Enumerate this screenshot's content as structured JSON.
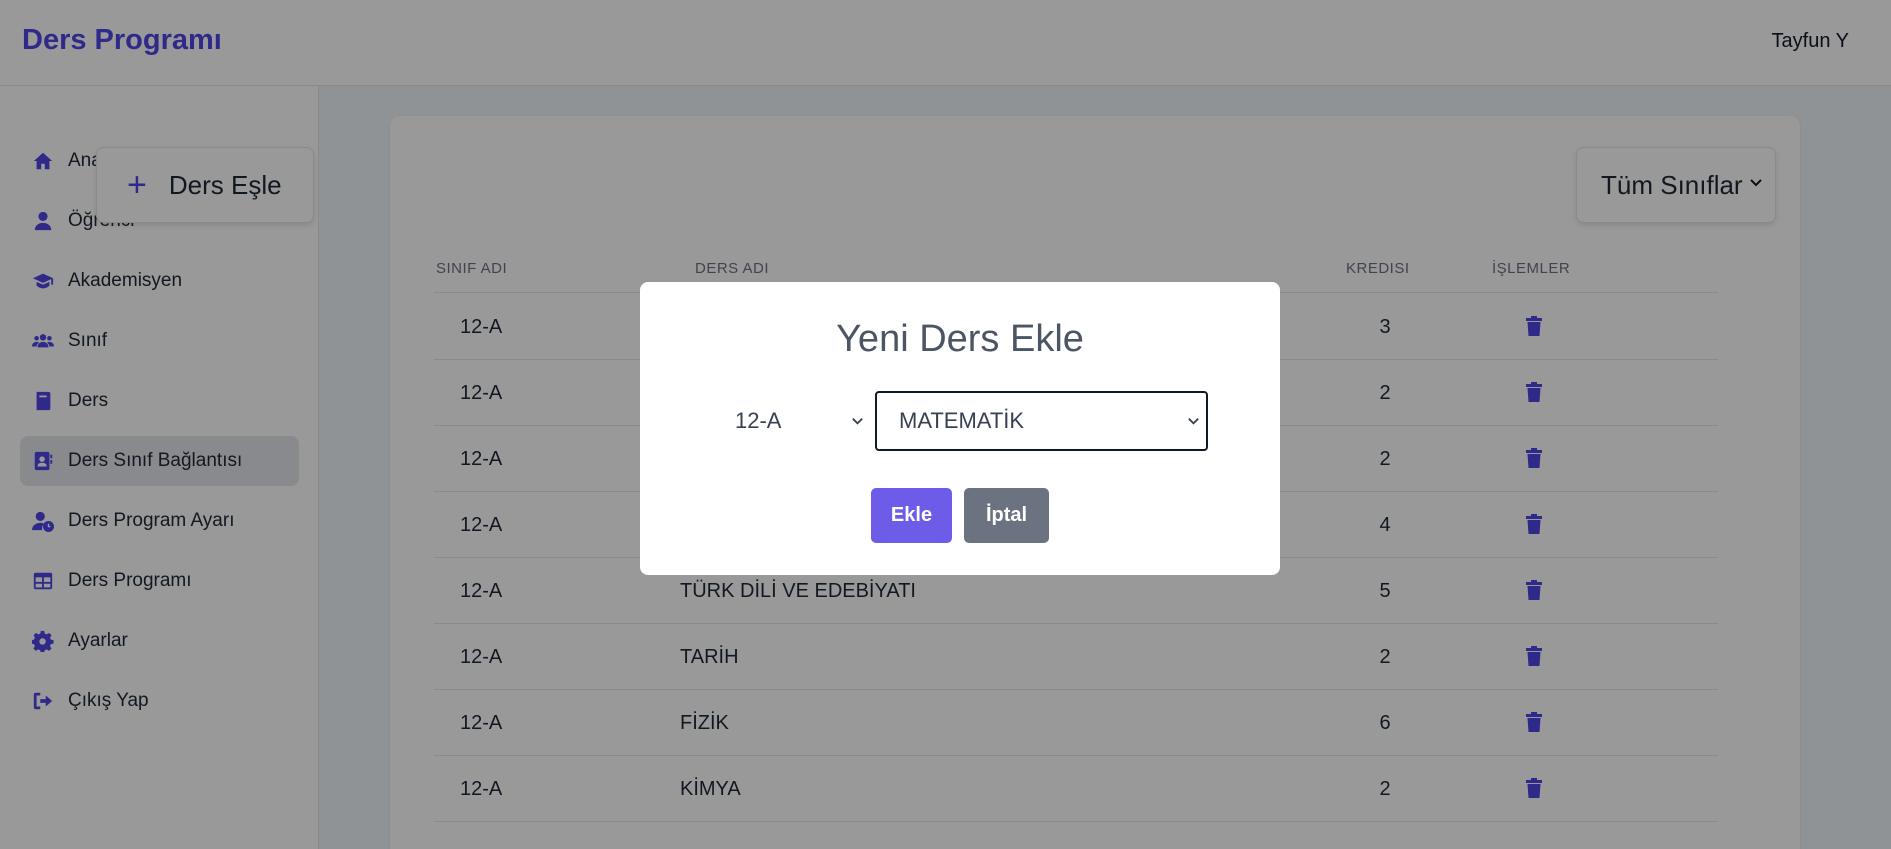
{
  "header": {
    "brand": "Ders Programı",
    "user": "Tayfun Y"
  },
  "colors": {
    "accent": "#4f46e5",
    "primary_button": "#6c5ce7",
    "secondary_button": "#6b7280",
    "overlay": "rgba(0,0,0,0.4)"
  },
  "sidebar": {
    "items": [
      {
        "label": "Anasayfa",
        "icon": "home-icon"
      },
      {
        "label": "Öğrenci",
        "icon": "user-icon"
      },
      {
        "label": "Akademisyen",
        "icon": "graduation-cap-icon"
      },
      {
        "label": "Sınıf",
        "icon": "users-icon"
      },
      {
        "label": "Ders",
        "icon": "book-icon"
      },
      {
        "label": "Ders Sınıf Bağlantısı",
        "icon": "address-book-icon",
        "active": true
      },
      {
        "label": "Ders Program Ayarı",
        "icon": "user-clock-icon"
      },
      {
        "label": "Ders Programı",
        "icon": "table-icon"
      },
      {
        "label": "Ayarlar",
        "icon": "gear-icon"
      },
      {
        "label": "Çıkış Yap",
        "icon": "logout-icon"
      }
    ]
  },
  "main": {
    "add_button": "Ders Eşle",
    "class_filter": "Tüm Sınıflar",
    "columns": {
      "class": "SINIF ADI",
      "course": "DERS ADI",
      "credit": "KREDISI",
      "actions": "İŞLEMLER"
    },
    "rows": [
      {
        "class": "12-A",
        "course": "",
        "credit": "3"
      },
      {
        "class": "12-A",
        "course": "",
        "credit": "2"
      },
      {
        "class": "12-A",
        "course": "",
        "credit": "2"
      },
      {
        "class": "12-A",
        "course": "",
        "credit": "4"
      },
      {
        "class": "12-A",
        "course": "TÜRK DİLİ VE EDEBİYATI",
        "credit": "5"
      },
      {
        "class": "12-A",
        "course": "TARİH",
        "credit": "2"
      },
      {
        "class": "12-A",
        "course": "FİZİK",
        "credit": "6"
      },
      {
        "class": "12-A",
        "course": "KİMYA",
        "credit": "2"
      }
    ]
  },
  "modal": {
    "title": "Yeni Ders Ekle",
    "class_value": "12-A",
    "course_value": "MATEMATİK",
    "save": "Ekle",
    "cancel": "İptal"
  }
}
